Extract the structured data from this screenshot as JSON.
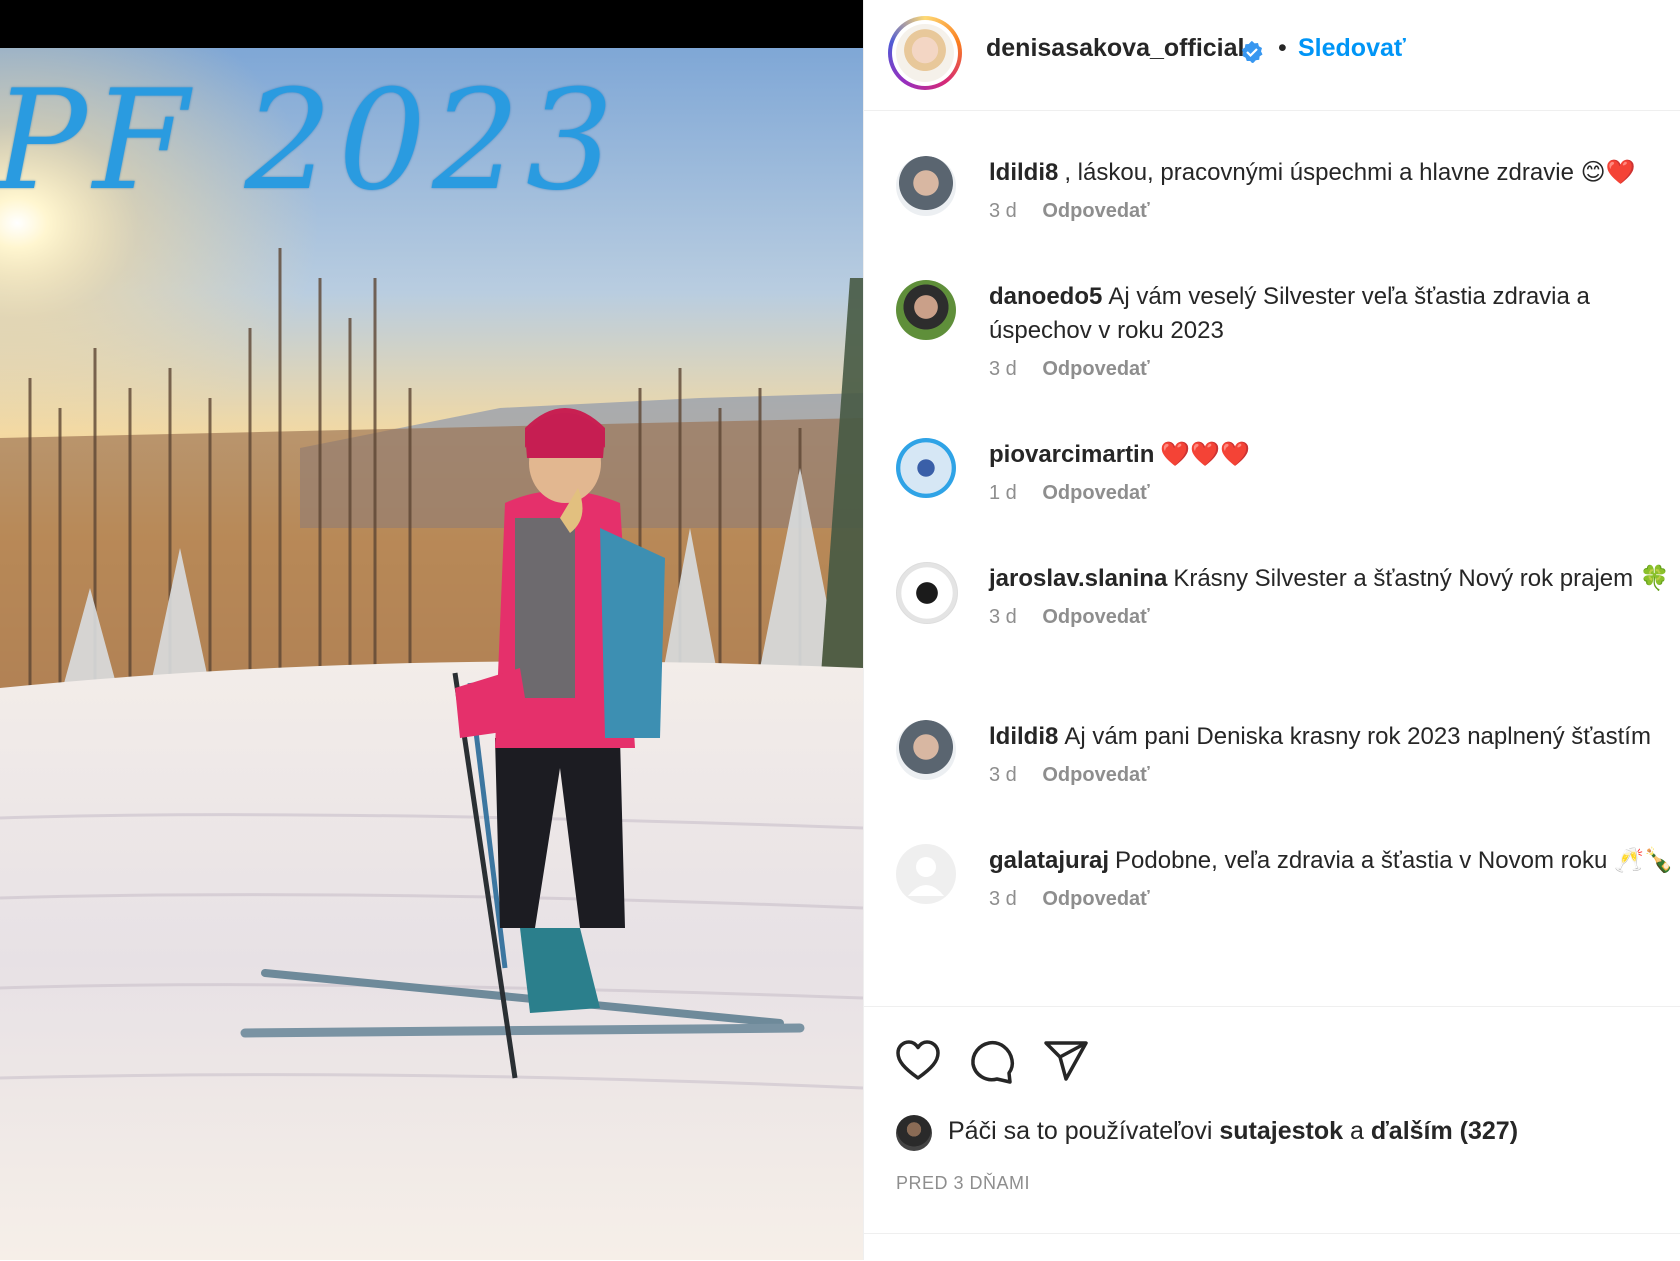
{
  "post": {
    "image_caption_text": "PF 2023"
  },
  "header": {
    "username": "denisasakova_official",
    "separator": "•",
    "follow_label": "Sledovať"
  },
  "comments": [
    {
      "user": "ldildi8",
      "text": ", láskou, pracovnými úspechmi a hlavne zdravie 😊❤️",
      "time": "3 d",
      "reply": "Odpovedať"
    },
    {
      "user": "danoedo5",
      "text": "Aj vám veselý Silvester veľa šťastia zdravia a úspechov v roku 2023",
      "time": "3 d",
      "reply": "Odpovedať"
    },
    {
      "user": "piovarcimartin",
      "text": "❤️❤️❤️",
      "time": "1 d",
      "reply": "Odpovedať"
    },
    {
      "user": "jaroslav.slanina",
      "text": "Krásny Silvester a šťastný Nový rok prajem 🍀",
      "time": "3 d",
      "reply": "Odpovedať"
    },
    {
      "user": "ldildi8",
      "text": "Aj vám pani Deniska krasny rok 2023 naplnený šťastím",
      "time": "3 d",
      "reply": "Odpovedať"
    },
    {
      "user": "galatajuraj",
      "text": "Podobne, veľa zdravia a šťastia v Novom roku 🥂🍾",
      "time": "3 d",
      "reply": "Odpovedať"
    }
  ],
  "likes": {
    "prefix": "Páči sa to používateľovi",
    "user": "sutajestok",
    "connector": "a",
    "others": "ďalším (327)"
  },
  "date_label": "PRED 3 DŇAMI"
}
